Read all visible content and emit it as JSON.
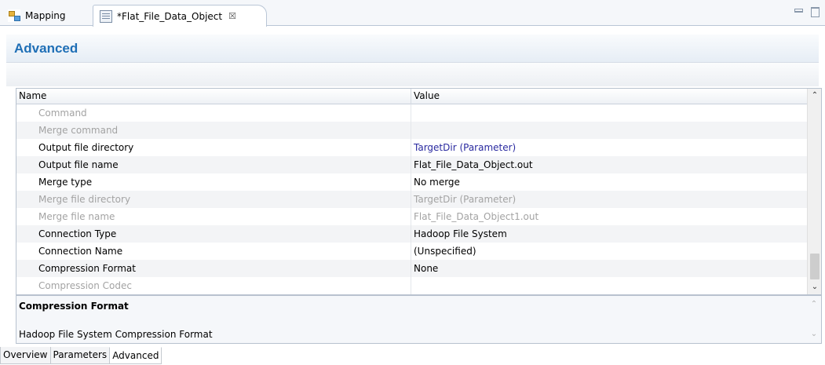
{
  "editor_tabs": [
    {
      "label": "Mapping",
      "icon": "mapping-icon",
      "active": false
    },
    {
      "label": "*Flat_File_Data_Object",
      "icon": "flat-file-data-object-icon",
      "active": true,
      "close": "☒"
    }
  ],
  "section": {
    "title": "Advanced"
  },
  "table": {
    "headers": {
      "name": "Name",
      "value": "Value"
    },
    "rows": [
      {
        "name": "Command",
        "value": "",
        "enabled": false
      },
      {
        "name": "Merge command",
        "value": "",
        "enabled": false
      },
      {
        "name": "Output file directory",
        "value": "TargetDir (Parameter)",
        "enabled": true,
        "parameter": true
      },
      {
        "name": "Output file name",
        "value": "Flat_File_Data_Object.out",
        "enabled": true
      },
      {
        "name": "Merge type",
        "value": "No merge",
        "enabled": true
      },
      {
        "name": "Merge file directory",
        "value": "TargetDir (Parameter)",
        "enabled": false,
        "parameter": true
      },
      {
        "name": "Merge file name",
        "value": "Flat_File_Data_Object1.out",
        "enabled": false
      },
      {
        "name": "Connection Type",
        "value": "Hadoop File System",
        "enabled": true
      },
      {
        "name": "Connection Name",
        "value": "(Unspecified)",
        "enabled": true
      },
      {
        "name": "Compression Format",
        "value": "None",
        "enabled": true
      },
      {
        "name": "Compression Codec",
        "value": "",
        "enabled": false
      }
    ]
  },
  "description": {
    "title": "Compression Format",
    "text": "Hadoop File System Compression Format"
  },
  "bottom_tabs": [
    {
      "label": "Overview",
      "active": false
    },
    {
      "label": "Parameters",
      "active": false
    },
    {
      "label": "Advanced",
      "active": true
    }
  ],
  "colors": {
    "section_title": "#1f6fb6",
    "parameter_value": "#2a2aa0",
    "disabled_text": "#a3a3a3"
  }
}
